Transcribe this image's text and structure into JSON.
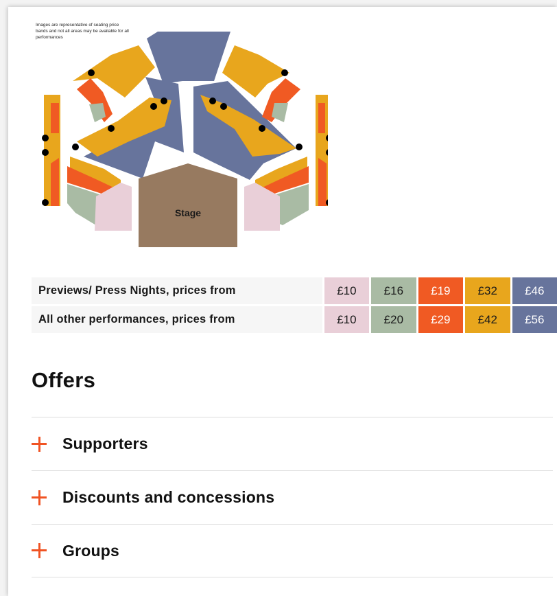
{
  "seating": {
    "note": "Images are representative of seating price bands and not all areas may be available for all performances",
    "stage_label": "Stage"
  },
  "price_table": {
    "band_colors": [
      "#e9cfd8",
      "#a9bba4",
      "#f05a23",
      "#e8a61d",
      "#67749c"
    ],
    "rows": [
      {
        "label": "Previews/ Press Nights, prices from",
        "prices": [
          "£10",
          "£16",
          "£19",
          "£32",
          "£46"
        ]
      },
      {
        "label": "All other performances, prices from",
        "prices": [
          "£10",
          "£20",
          "£29",
          "£42",
          "£56"
        ]
      }
    ]
  },
  "offers": {
    "title": "Offers",
    "items": [
      {
        "label": "Supporters"
      },
      {
        "label": "Discounts and concessions"
      },
      {
        "label": "Groups"
      }
    ]
  }
}
